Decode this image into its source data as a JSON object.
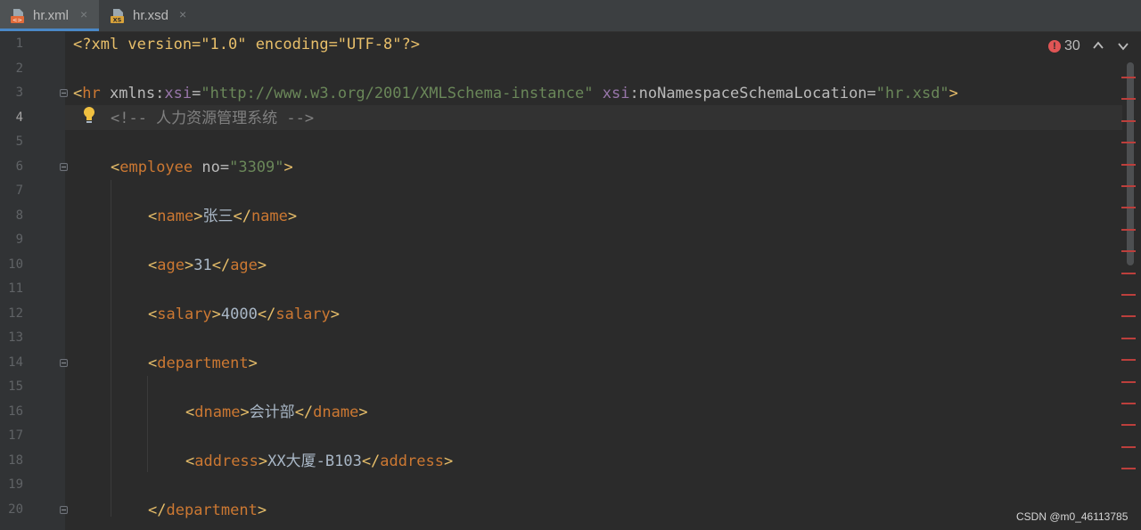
{
  "tabs": [
    {
      "label": "hr.xml",
      "close": "×",
      "icon": "xml-file-icon",
      "active": true
    },
    {
      "label": "hr.xsd",
      "close": "×",
      "icon": "xsd-file-icon",
      "active": false
    }
  ],
  "editor": {
    "current_line": 4,
    "lines": [
      {
        "n": "1",
        "indent": 0,
        "fold": false,
        "tokens": [
          [
            "pi",
            "<?xml version=\"1.0\" encoding=\"UTF-8\"?>"
          ]
        ]
      },
      {
        "n": "2",
        "indent": 0,
        "fold": false,
        "tokens": []
      },
      {
        "n": "3",
        "indent": 0,
        "fold": true,
        "tokens": [
          [
            "br",
            "<"
          ],
          [
            "tag",
            "hr"
          ],
          [
            "attr",
            " xmlns:"
          ],
          [
            "ns",
            "xsi"
          ],
          [
            "attr",
            "="
          ],
          [
            "val",
            "\"http://www.w3.org/2001/XMLSchema-instance\""
          ],
          [
            "attr",
            " "
          ],
          [
            "ns",
            "xsi"
          ],
          [
            "attr",
            ":noNamespaceSchemaLocation="
          ],
          [
            "val",
            "\"hr.xsd\""
          ],
          [
            "br",
            ">"
          ]
        ]
      },
      {
        "n": "4",
        "indent": 1,
        "fold": false,
        "tokens": [
          [
            "com",
            "<!-- 人力资源管理系统 -->"
          ]
        ]
      },
      {
        "n": "5",
        "indent": 0,
        "fold": false,
        "tokens": []
      },
      {
        "n": "6",
        "indent": 1,
        "fold": true,
        "tokens": [
          [
            "br",
            "<"
          ],
          [
            "tag",
            "employee"
          ],
          [
            "attr",
            " no="
          ],
          [
            "val",
            "\"3309\""
          ],
          [
            "br",
            ">"
          ]
        ]
      },
      {
        "n": "7",
        "indent": 0,
        "fold": false,
        "tokens": []
      },
      {
        "n": "8",
        "indent": 2,
        "fold": false,
        "tokens": [
          [
            "br",
            "<"
          ],
          [
            "tag",
            "name"
          ],
          [
            "br",
            ">"
          ],
          [
            "txt",
            "张三"
          ],
          [
            "br",
            "</"
          ],
          [
            "tag",
            "name"
          ],
          [
            "br",
            ">"
          ]
        ]
      },
      {
        "n": "9",
        "indent": 0,
        "fold": false,
        "tokens": []
      },
      {
        "n": "10",
        "indent": 2,
        "fold": false,
        "tokens": [
          [
            "br",
            "<"
          ],
          [
            "tag",
            "age"
          ],
          [
            "br",
            ">"
          ],
          [
            "txt",
            "31"
          ],
          [
            "br",
            "</"
          ],
          [
            "tag",
            "age"
          ],
          [
            "br",
            ">"
          ]
        ]
      },
      {
        "n": "11",
        "indent": 0,
        "fold": false,
        "tokens": []
      },
      {
        "n": "12",
        "indent": 2,
        "fold": false,
        "tokens": [
          [
            "br",
            "<"
          ],
          [
            "tag",
            "salary"
          ],
          [
            "br",
            ">"
          ],
          [
            "txt",
            "4000"
          ],
          [
            "br",
            "</"
          ],
          [
            "tag",
            "salary"
          ],
          [
            "br",
            ">"
          ]
        ]
      },
      {
        "n": "13",
        "indent": 0,
        "fold": false,
        "tokens": []
      },
      {
        "n": "14",
        "indent": 2,
        "fold": true,
        "tokens": [
          [
            "br",
            "<"
          ],
          [
            "tag",
            "department"
          ],
          [
            "br",
            ">"
          ]
        ]
      },
      {
        "n": "15",
        "indent": 0,
        "fold": false,
        "tokens": []
      },
      {
        "n": "16",
        "indent": 3,
        "fold": false,
        "tokens": [
          [
            "br",
            "<"
          ],
          [
            "tag",
            "dname"
          ],
          [
            "br",
            ">"
          ],
          [
            "txt",
            "会计部"
          ],
          [
            "br",
            "</"
          ],
          [
            "tag",
            "dname"
          ],
          [
            "br",
            ">"
          ]
        ]
      },
      {
        "n": "17",
        "indent": 0,
        "fold": false,
        "tokens": []
      },
      {
        "n": "18",
        "indent": 3,
        "fold": false,
        "tokens": [
          [
            "br",
            "<"
          ],
          [
            "tag",
            "address"
          ],
          [
            "br",
            ">"
          ],
          [
            "txt",
            "XX大厦-B103"
          ],
          [
            "br",
            "</"
          ],
          [
            "tag",
            "address"
          ],
          [
            "br",
            ">"
          ]
        ]
      },
      {
        "n": "19",
        "indent": 0,
        "fold": false,
        "tokens": []
      },
      {
        "n": "20",
        "indent": 2,
        "fold": true,
        "tokens": [
          [
            "br",
            "</"
          ],
          [
            "tag",
            "department"
          ],
          [
            "br",
            ">"
          ]
        ]
      }
    ]
  },
  "inspection": {
    "error_count": "30",
    "error_icon": "!",
    "prev_icon": "chevron-up-icon",
    "next_icon": "chevron-down-icon"
  },
  "error_stripe_count": 19,
  "watermark": "CSDN @m0_46113785",
  "colors": {
    "background": "#2b2b2b",
    "tag": "#cc7832",
    "bracket": "#e8bf6a",
    "string": "#6a8759",
    "namespace": "#9876aa",
    "comment": "#808080",
    "error": "#bc3f3c"
  }
}
